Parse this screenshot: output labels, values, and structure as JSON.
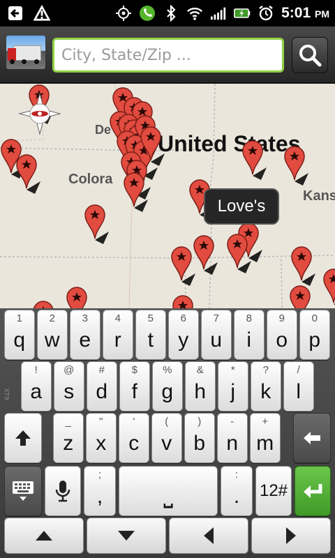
{
  "status_bar": {
    "time": "5:01",
    "ampm": "PM",
    "icons": [
      "back-arrow-icon",
      "warning-icon",
      "gps-icon",
      "phone-icon",
      "bluetooth-icon",
      "wifi-icon",
      "signal-icon",
      "battery-charging-icon",
      "alarm-icon"
    ]
  },
  "search": {
    "placeholder": "City, State/Zip ...",
    "value": "",
    "accent_color": "#8fd145"
  },
  "map": {
    "region_label": "United States",
    "labels": [
      "De",
      "Colora",
      "Kans"
    ],
    "tooltip": "Love's",
    "pin_color": "#e24b3f"
  },
  "keyboard": {
    "row1": [
      {
        "primary": "q",
        "secondary": "1"
      },
      {
        "primary": "w",
        "secondary": "2"
      },
      {
        "primary": "e",
        "secondary": "3"
      },
      {
        "primary": "r",
        "secondary": "4"
      },
      {
        "primary": "t",
        "secondary": "5"
      },
      {
        "primary": "y",
        "secondary": "6"
      },
      {
        "primary": "u",
        "secondary": "7"
      },
      {
        "primary": "i",
        "secondary": "8"
      },
      {
        "primary": "o",
        "secondary": "9"
      },
      {
        "primary": "p",
        "secondary": "0"
      }
    ],
    "row2": [
      {
        "primary": "a",
        "secondary": "!"
      },
      {
        "primary": "s",
        "secondary": "@"
      },
      {
        "primary": "d",
        "secondary": "#"
      },
      {
        "primary": "f",
        "secondary": "$"
      },
      {
        "primary": "g",
        "secondary": "%"
      },
      {
        "primary": "h",
        "secondary": "&"
      },
      {
        "primary": "j",
        "secondary": "*"
      },
      {
        "primary": "k",
        "secondary": "?"
      },
      {
        "primary": "l",
        "secondary": "/"
      }
    ],
    "row3": [
      {
        "primary": "z",
        "secondary": "_"
      },
      {
        "primary": "x",
        "secondary": "\""
      },
      {
        "primary": "c",
        "secondary": "'"
      },
      {
        "primary": "v",
        "secondary": "("
      },
      {
        "primary": "b",
        "secondary": ")"
      },
      {
        "primary": "n",
        "secondary": "-"
      },
      {
        "primary": "m",
        "secondary": "+"
      }
    ],
    "comma": {
      "primary": ",",
      "secondary": ";"
    },
    "period": {
      "primary": ".",
      "secondary": ":"
    },
    "space": "⎵",
    "symbols": "12#",
    "side_mark": "XT9"
  }
}
